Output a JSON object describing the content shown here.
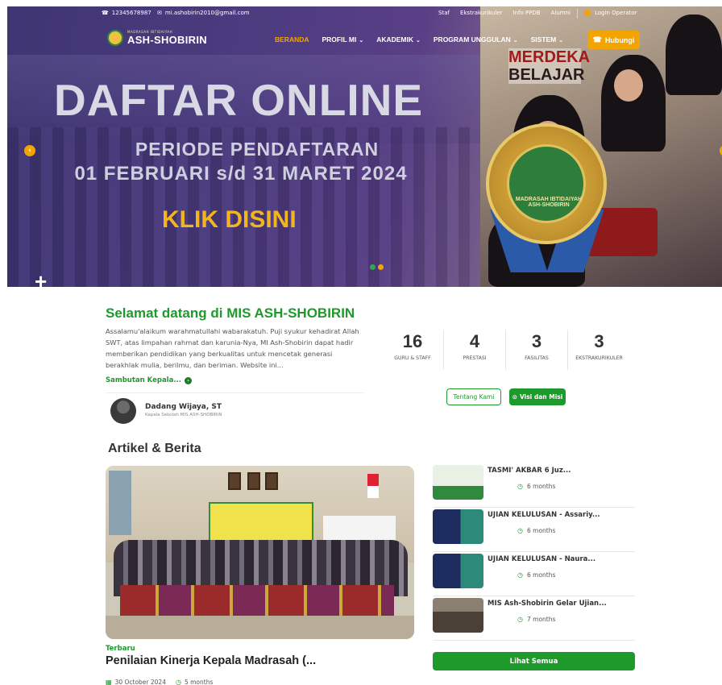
{
  "topbar": {
    "phone": "12345678987",
    "email": "mi.ashobirin2010@gmail.com",
    "links": [
      "Staf",
      "Ekstrakurikuler",
      "Info PPDB",
      "Alumni"
    ],
    "login": "Login Operator"
  },
  "logo": {
    "small": "MADRASAH IBTIDAIYAH",
    "name": "ASH-SHOBIRIN"
  },
  "nav": {
    "items": [
      "BERANDA",
      "PROFIL MI",
      "AKADEMIK",
      "PROGRAM UNGGULAN",
      "SISTEM"
    ],
    "contact_button": "Hubungi"
  },
  "hero": {
    "title": "DAFTAR ONLINE",
    "subtitle1": "PERIODE PENDAFTARAN",
    "subtitle2": "01 FEBRUARI s/d 31 MARET 2024",
    "cta": "KLIK DISINI",
    "badge_line1": "MERDEKA",
    "badge_line2": "BELAJAR",
    "medal_text": "MADRASAH IBTIDAIYAH ASH-SHOBIRIN"
  },
  "welcome": {
    "title": "Selamat datang di MIS ASH-SHOBIRIN",
    "text": "Assalamu'alaikum warahmatullahi wabarakatuh. Puji syukur kehadirat Allah SWT, atas limpahan rahmat dan karunia-Nya, MI Ash-Shobirin dapat hadir memberikan pendidikan yang berkualitas untuk mencetak generasi berakhlak mulia, berilmu, dan beriman. Website ini...",
    "link": "Sambutan Kepala...",
    "head_name": "Dadang Wijaya, ST",
    "head_role": "Kepala Sekolah MIS ASH-SHOBIRIN"
  },
  "stats": [
    {
      "value": "16",
      "label": "GURU & STAFF"
    },
    {
      "value": "4",
      "label": "PRESTASI"
    },
    {
      "value": "3",
      "label": "FASILITAS"
    },
    {
      "value": "3",
      "label": "EKSTRAKURIKULER"
    }
  ],
  "buttons": {
    "about": "Tentang Kami",
    "vision": "Visi dan Misi"
  },
  "articles": {
    "section_title": "Artikel & Berita",
    "featured": {
      "tag": "Terbaru",
      "title": "Penilaian Kinerja Kepala Madrasah (...",
      "date": "30 October 2024",
      "ago": "5 months"
    },
    "side": [
      {
        "title": "TASMI' AKBAR 6 Juz...",
        "ago": "6 months"
      },
      {
        "title": "UJIAN KELULUSAN - Assariy...",
        "ago": "6 months"
      },
      {
        "title": "UJIAN KELULUSAN - Naura...",
        "ago": "6 months"
      },
      {
        "title": "MIS Ash-Shobirin Gelar Ujian...",
        "ago": "7 months"
      }
    ],
    "see_all": "Lihat Semua"
  },
  "colors": {
    "green": "#1e9a2c",
    "orange": "#f2a500"
  }
}
